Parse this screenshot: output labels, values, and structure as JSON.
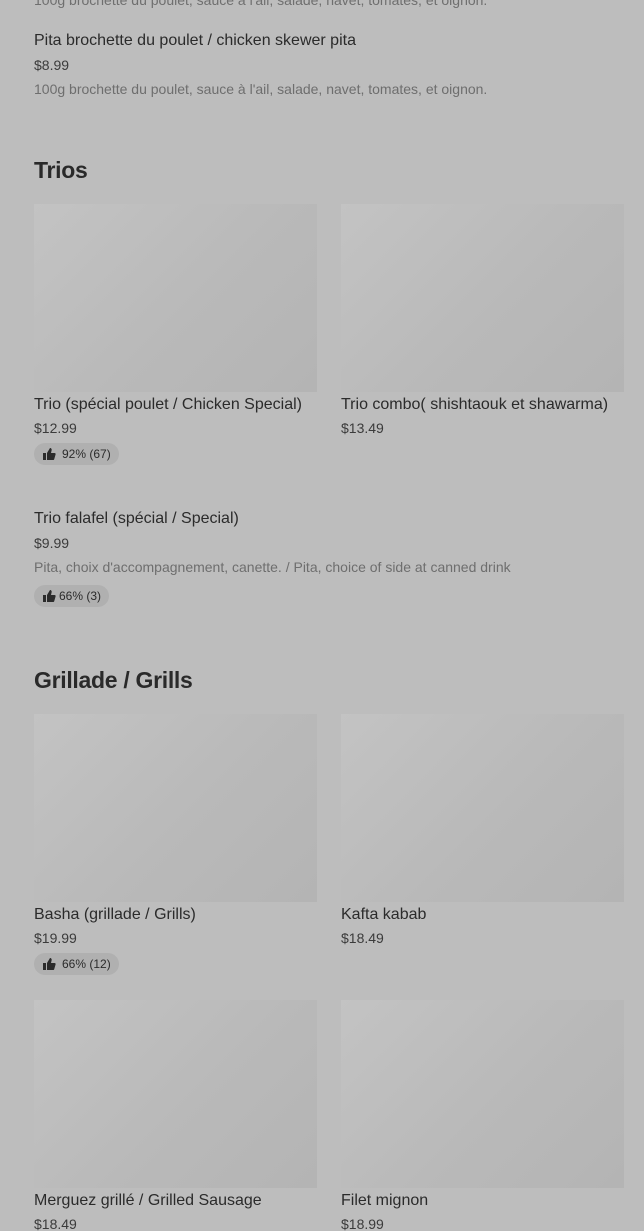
{
  "top_item": {
    "cut_desc": "100g brochette du poulet, sauce à l'ail, salade, navet, tomates, et oignon.",
    "name": "Pita brochette du poulet / chicken skewer pita",
    "price": "$8.99",
    "desc": "100g brochette du poulet, sauce à l'ail, salade, navet, tomates, et oignon."
  },
  "sections": {
    "trios": {
      "title": "Trios",
      "cards": [
        {
          "name": "Trio (spécial poulet / Chicken Special)",
          "price": "$12.99",
          "rating": "92% (67)"
        },
        {
          "name": "Trio combo( shishtaouk et shawarma)",
          "price": "$13.49"
        }
      ],
      "list_item": {
        "name": "Trio falafel (spécial / Special)",
        "price": "$9.99",
        "desc": "Pita, choix d'accompagnement, canette. / Pita, choice of side at canned drink",
        "rating": "66% (3)"
      }
    },
    "grills": {
      "title": "Grillade / Grills",
      "cards": [
        {
          "name": "Basha (grillade / Grills)",
          "price": "$19.99",
          "rating": "66% (12)"
        },
        {
          "name": "Kafta kabab",
          "price": "$18.49"
        },
        {
          "name": "Merguez grillé / Grilled Sausage",
          "price": "$18.49"
        },
        {
          "name": "Filet mignon",
          "price": "$18.99"
        }
      ]
    }
  },
  "icons": {
    "rating": "thumbs-up-icon"
  },
  "colors": {
    "background": "#bdbdbd",
    "image_placeholder": "#bebebe",
    "rating_badge": "#b0b0b0"
  }
}
